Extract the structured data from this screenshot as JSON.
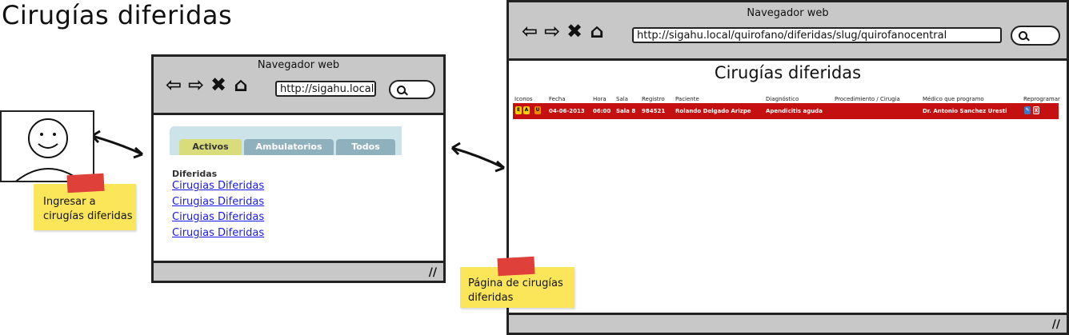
{
  "page_title": "Cirugías diferidas",
  "small_browser": {
    "title": "Navegador web",
    "url": "http://sigahu.local",
    "nav_icons": [
      "back-arrow-icon",
      "forward-arrow-icon",
      "stop-icon",
      "home-icon"
    ],
    "tabs": [
      "Activos",
      "Ambulatorios",
      "Todos"
    ],
    "section": "Diferidas",
    "links": [
      "Cirugias Diferidas",
      "Cirugias Diferidas",
      "Cirugias Diferidas",
      "Cirugias Diferidas"
    ]
  },
  "large_browser": {
    "title": "Navegador web",
    "url": "http://sigahu.local/quirofano/diferidas/slug/quirofanocentral",
    "heading": "Cirugías diferidas",
    "table": {
      "headers": [
        "Iconos",
        "Fecha",
        "Hora",
        "Sala",
        "Registro",
        "Paciente",
        "Diagnóstico",
        "Procedimiento / Cirugia",
        "Médico que programo",
        "Reprogramar"
      ],
      "row": {
        "fecha": "04-06-2013",
        "hora": "06:00",
        "sala": "Sala 8",
        "registro": "984521",
        "paciente": "Rolando Delgado Arizpe",
        "diagnostico": "Apendicitis aguda",
        "procedimiento": "",
        "medico": "Dr. Antonio Sanchez Uresti"
      },
      "row_color": "#c41010"
    }
  },
  "notes": {
    "left": "Ingresar a cirugías diferidas",
    "right": "Página de cirugías diferidas"
  },
  "colors": {
    "note": "#fbe65a",
    "tape": "#e0403a",
    "chrome": "#c8c8c8",
    "active_tab": "#d8dc7a",
    "tab": "#8fb0bd"
  }
}
